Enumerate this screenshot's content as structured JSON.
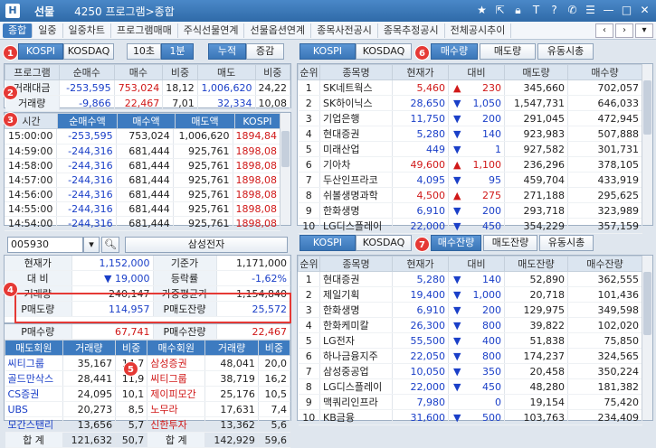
{
  "window": {
    "market": "선물",
    "title": "4250 프로그램>종합",
    "icon": "H"
  },
  "tabs": [
    "종합",
    "일중",
    "일중차트",
    "프로그램매매",
    "주식선물연계",
    "선물옵션연계",
    "종목사전공시",
    "종목추정공시",
    "전체공시추이"
  ],
  "topleft": {
    "kospi": "KOSPI",
    "kosdaq": "KOSDAQ",
    "sec10": "10초",
    "min1": "1분",
    "cum": "누적",
    "chg": "증감"
  },
  "program": {
    "headers": [
      "프로그램",
      "순매수",
      "매수",
      "비중",
      "매도",
      "비중"
    ],
    "rows": [
      [
        "거래대금",
        "-253,595",
        "753,024",
        "18,12",
        "1,006,620",
        "24,22"
      ],
      [
        "거래량",
        "-9,866",
        "22,467",
        "7,01",
        "32,334",
        "10,08"
      ]
    ]
  },
  "timeseries": {
    "headers": [
      "시간",
      "순매수액",
      "매수액",
      "매도액",
      "KOSPI"
    ],
    "rows": [
      [
        "15:00:00",
        "-253,595",
        "753,024",
        "1,006,620",
        "1894,84"
      ],
      [
        "14:59:00",
        "-244,316",
        "681,444",
        "925,761",
        "1898,08"
      ],
      [
        "14:58:00",
        "-244,316",
        "681,444",
        "925,761",
        "1898,08"
      ],
      [
        "14:57:00",
        "-244,316",
        "681,444",
        "925,761",
        "1898,08"
      ],
      [
        "14:56:00",
        "-244,316",
        "681,444",
        "925,761",
        "1898,08"
      ],
      [
        "14:55:00",
        "-244,316",
        "681,444",
        "925,761",
        "1898,08"
      ],
      [
        "14:54:00",
        "-244,316",
        "681,444",
        "925,761",
        "1898,08"
      ]
    ]
  },
  "stock": {
    "code": "005930",
    "name": "삼성전자",
    "rows": [
      [
        "현재가",
        "1,152,000",
        "기준가",
        "1,171,000"
      ],
      [
        "대  비",
        "19,000",
        "등락률",
        "-1,62%"
      ],
      [
        "거래량",
        "240,147",
        "가중평균가",
        "1,154,840"
      ]
    ],
    "prows": [
      [
        "P매도량",
        "114,957",
        "P매도잔량",
        "25,572"
      ],
      [
        "P매수량",
        "67,741",
        "P매수잔량",
        "22,467"
      ]
    ]
  },
  "members": {
    "headers": [
      "매도회원",
      "거래량",
      "비중",
      "매수회원",
      "거래량",
      "비중"
    ],
    "rows": [
      [
        "씨티그룹",
        "35,167",
        "14,7",
        "삼성증권",
        "48,041",
        "20,0"
      ],
      [
        "골드만삭스",
        "28,441",
        "11,9",
        "씨티그룹",
        "38,719",
        "16,2"
      ],
      [
        "CS증권",
        "24,095",
        "10,1",
        "제이피모간",
        "25,176",
        "10,5"
      ],
      [
        "UBS",
        "20,273",
        "8,5",
        "노무라",
        "17,631",
        "7,4"
      ],
      [
        "모간스탠리",
        "13,656",
        "5,7",
        "신한투자",
        "13,362",
        "5,6"
      ]
    ],
    "total": [
      "합  계",
      "121,632",
      "50,7",
      "합  계",
      "142,929",
      "59,6"
    ]
  },
  "rank1": {
    "buttons": [
      "KOSPI",
      "KOSDAQ",
      "매수량",
      "매도량",
      "유동시총"
    ],
    "headers": [
      "순위",
      "종목명",
      "현재가",
      "대비",
      "매도량",
      "매수량"
    ],
    "rows": [
      [
        "1",
        "SK네트웍스",
        "5,460",
        "▲",
        "230",
        "345,660",
        "702,057"
      ],
      [
        "2",
        "SK하이닉스",
        "28,650",
        "▼",
        "1,050",
        "1,547,731",
        "646,033"
      ],
      [
        "3",
        "기업은행",
        "11,750",
        "▼",
        "200",
        "291,045",
        "472,945"
      ],
      [
        "4",
        "현대증권",
        "5,280",
        "▼",
        "140",
        "923,983",
        "507,888"
      ],
      [
        "5",
        "미래산업",
        "449",
        "▼",
        "1",
        "927,582",
        "301,731"
      ],
      [
        "6",
        "기아차",
        "49,600",
        "▲",
        "1,100",
        "236,296",
        "378,105"
      ],
      [
        "7",
        "두산인프라코",
        "4,095",
        "▼",
        "95",
        "459,704",
        "433,919"
      ],
      [
        "8",
        "쉬볼생명과학",
        "4,500",
        "▲",
        "275",
        "271,188",
        "295,625"
      ],
      [
        "9",
        "한화생명",
        "6,910",
        "▼",
        "200",
        "293,718",
        "323,989"
      ],
      [
        "10",
        "LG디스플레이",
        "22,000",
        "▼",
        "450",
        "354,229",
        "357,159"
      ]
    ]
  },
  "rank2": {
    "buttons": [
      "KOSPI",
      "KOSDAQ",
      "매수잔량",
      "매도잔량",
      "유동시총"
    ],
    "headers": [
      "순위",
      "종목명",
      "현재가",
      "대비",
      "매도잔량",
      "매수잔량"
    ],
    "rows": [
      [
        "1",
        "현대증권",
        "5,280",
        "▼",
        "140",
        "52,890",
        "362,555"
      ],
      [
        "2",
        "제일기획",
        "19,400",
        "▼",
        "1,000",
        "20,718",
        "101,436"
      ],
      [
        "3",
        "한화생명",
        "6,910",
        "▼",
        "200",
        "129,975",
        "349,598"
      ],
      [
        "4",
        "한화케미칼",
        "26,300",
        "▼",
        "800",
        "39,822",
        "102,020"
      ],
      [
        "5",
        "LG전자",
        "55,500",
        "▼",
        "400",
        "51,838",
        "75,850"
      ],
      [
        "6",
        "하나금융지주",
        "22,050",
        "▼",
        "800",
        "174,237",
        "324,565"
      ],
      [
        "7",
        "삼성중공업",
        "10,050",
        "▼",
        "350",
        "20,458",
        "350,224"
      ],
      [
        "8",
        "LG디스플레이",
        "22,000",
        "▼",
        "450",
        "48,280",
        "181,382"
      ],
      [
        "9",
        "맥쿼리인프라",
        "7,980",
        "",
        "0",
        "19,154",
        "75,420"
      ],
      [
        "10",
        "KB금융",
        "31,600",
        "▼",
        "500",
        "103,763",
        "234,409"
      ]
    ]
  },
  "badges": [
    "1",
    "2",
    "3",
    "4",
    "5",
    "6",
    "7"
  ]
}
